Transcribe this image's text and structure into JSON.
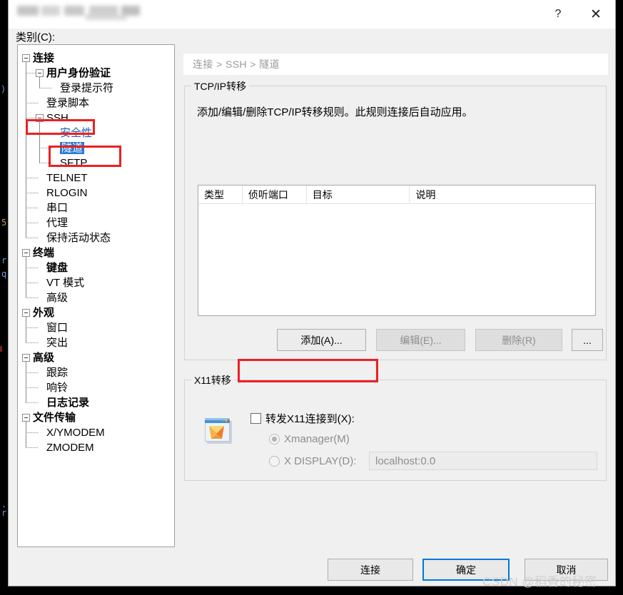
{
  "window": {
    "title_censored": true,
    "help_icon": "?",
    "close_icon": "✕"
  },
  "category_label": "类别(C):",
  "tree": {
    "items": [
      {
        "label": "连接",
        "depth": 0,
        "bold": true,
        "expander": true,
        "selected": false,
        "visited": false
      },
      {
        "label": "用户身份验证",
        "depth": 1,
        "bold": true,
        "expander": true,
        "selected": false,
        "visited": false
      },
      {
        "label": "登录提示符",
        "depth": 2,
        "bold": false,
        "expander": false,
        "selected": false,
        "visited": false
      },
      {
        "label": "登录脚本",
        "depth": 1,
        "bold": false,
        "expander": false,
        "selected": false,
        "visited": false
      },
      {
        "label": "SSH",
        "depth": 1,
        "bold": false,
        "expander": true,
        "selected": false,
        "visited": false
      },
      {
        "label": "安全性",
        "depth": 2,
        "bold": false,
        "expander": false,
        "selected": false,
        "visited": true
      },
      {
        "label": "隧道",
        "depth": 2,
        "bold": false,
        "expander": false,
        "selected": true,
        "visited": false
      },
      {
        "label": "SFTP",
        "depth": 2,
        "bold": false,
        "expander": false,
        "selected": false,
        "visited": false
      },
      {
        "label": "TELNET",
        "depth": 1,
        "bold": false,
        "expander": false,
        "selected": false,
        "visited": false
      },
      {
        "label": "RLOGIN",
        "depth": 1,
        "bold": false,
        "expander": false,
        "selected": false,
        "visited": false
      },
      {
        "label": "串口",
        "depth": 1,
        "bold": false,
        "expander": false,
        "selected": false,
        "visited": false
      },
      {
        "label": "代理",
        "depth": 1,
        "bold": false,
        "expander": false,
        "selected": false,
        "visited": false
      },
      {
        "label": "保持活动状态",
        "depth": 1,
        "bold": false,
        "expander": false,
        "selected": false,
        "visited": false
      },
      {
        "label": "终端",
        "depth": 0,
        "bold": true,
        "expander": true,
        "selected": false,
        "visited": false
      },
      {
        "label": "键盘",
        "depth": 1,
        "bold": true,
        "expander": false,
        "selected": false,
        "visited": false
      },
      {
        "label": "VT 模式",
        "depth": 1,
        "bold": false,
        "expander": false,
        "selected": false,
        "visited": false
      },
      {
        "label": "高级",
        "depth": 1,
        "bold": false,
        "expander": false,
        "selected": false,
        "visited": false
      },
      {
        "label": "外观",
        "depth": 0,
        "bold": true,
        "expander": true,
        "selected": false,
        "visited": false
      },
      {
        "label": "窗口",
        "depth": 1,
        "bold": false,
        "expander": false,
        "selected": false,
        "visited": false
      },
      {
        "label": "突出",
        "depth": 1,
        "bold": false,
        "expander": false,
        "selected": false,
        "visited": false
      },
      {
        "label": "高级",
        "depth": 0,
        "bold": true,
        "expander": true,
        "selected": false,
        "visited": false
      },
      {
        "label": "跟踪",
        "depth": 1,
        "bold": false,
        "expander": false,
        "selected": false,
        "visited": false
      },
      {
        "label": "响铃",
        "depth": 1,
        "bold": false,
        "expander": false,
        "selected": false,
        "visited": false
      },
      {
        "label": "日志记录",
        "depth": 1,
        "bold": true,
        "expander": false,
        "selected": false,
        "visited": false
      },
      {
        "label": "文件传输",
        "depth": 0,
        "bold": true,
        "expander": true,
        "selected": false,
        "visited": false
      },
      {
        "label": "X/YMODEM",
        "depth": 1,
        "bold": false,
        "expander": false,
        "selected": false,
        "visited": false
      },
      {
        "label": "ZMODEM",
        "depth": 1,
        "bold": false,
        "expander": false,
        "selected": false,
        "visited": false
      }
    ]
  },
  "breadcrumb": "连接 > SSH > 隧道",
  "tcpip": {
    "group_title": "TCP/IP转移",
    "description": "添加/编辑/删除TCP/IP转移规则。此规则连接后自动应用。",
    "columns": [
      "类型",
      "侦听端口",
      "目标",
      "说明"
    ],
    "rows": [],
    "buttons": [
      {
        "label": "添加(A)...",
        "accel": "A",
        "disabled": false
      },
      {
        "label": "编辑(E)...",
        "accel": "E",
        "disabled": true
      },
      {
        "label": "删除(R)",
        "accel": "R",
        "disabled": true
      },
      {
        "label": "...",
        "accel": "",
        "disabled": false
      }
    ]
  },
  "x11": {
    "group_title": "X11转移",
    "icon": "xmanager-icon",
    "checkbox_label": "转发X11连接到(X):",
    "checkbox_checked": false,
    "radio_xmanager": "Xmanager(M)",
    "radio_xmanager_selected": true,
    "radio_xdisplay": "X DISPLAY(D):",
    "radio_xdisplay_selected": false,
    "xdisplay_placeholder": "localhost:0.0",
    "xdisplay_value": "",
    "controls_disabled": true
  },
  "footer": {
    "connect": "连接",
    "ok": "确定",
    "cancel": "取消",
    "focused": "ok"
  },
  "annotations": {
    "color": "#ec2024",
    "boxes": [
      "tree-item-ssh",
      "tree-item-tunnel",
      "x11-forward-checkbox"
    ]
  },
  "watermark": "CSDN @稻香的秘密",
  "terminal_background": {
    "color": "#000000",
    "fragments": [
      ")",
      "5",
      "r",
      "q",
      ".",
      "r"
    ]
  }
}
